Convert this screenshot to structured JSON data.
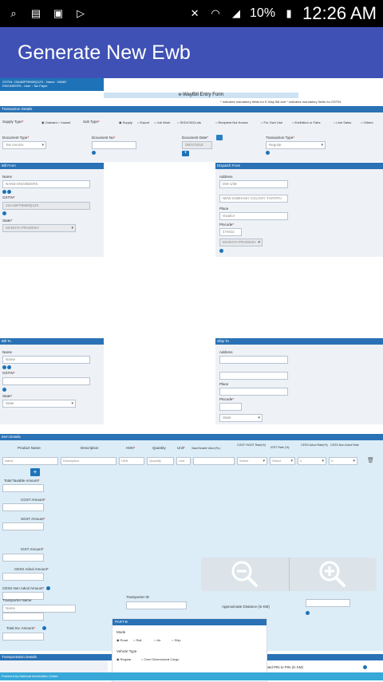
{
  "statusbar": {
    "battery": "10%",
    "time": "12:26 AM"
  },
  "appbar": {
    "title": "Generate New Ewb"
  },
  "web": {
    "userbar_line1": "GSTIN: 23AABFP8969Q1ZX - Name : NAND",
    "userbar_line2": "ENGINEERS - User : Tax Payer",
    "form_title": "e-WayBill Entry Form",
    "mandatory_note": "* Indicates mandatory fields for E-Way Bill and * indicates mandatory fields for GSTIN",
    "transaction_details": {
      "header": "Transaction Details",
      "supply_type_label": "Supply Type",
      "supply_options": [
        "Outward",
        "Inward"
      ],
      "sub_type_label": "Sub Type",
      "sub_types": [
        "Supply",
        "Export",
        "Job Work",
        "SKD/CKD/Lots",
        "Recipient Not Known",
        "For Own Use",
        "Exhibition or Fairs",
        "Line Sales",
        "Others"
      ],
      "doc_type_label": "Document Type",
      "doc_type_value": "Tax Invoice",
      "doc_no_label": "Document No",
      "doc_date_label": "Document Date",
      "doc_date_value": "05/07/2018",
      "transaction_type_label": "Transaction Type",
      "transaction_type_value": "Regular"
    },
    "bill_from": {
      "header": "Bill From",
      "name_label": "Name",
      "name_value": "NAND ENGINEERS",
      "gstin_label": "GSTIN",
      "gstin_value": "23AABFP8969Q1ZX",
      "state_label": "State",
      "state_value": "MADHYA PRADESH"
    },
    "dispatch_from": {
      "header": "Dispatch From",
      "address_label": "Address",
      "address1": "DW-1/38",
      "address2": "NEW SUBHASH COLONY THATIPU",
      "place_label": "Place",
      "place_value": "Gwalior",
      "pincode_label": "Pincode",
      "pincode_value": "474011",
      "state_value": "MADHYA PRADESH"
    },
    "bill_to": {
      "header": "Bill To",
      "name_label": "Name",
      "name_placeholder": "Name",
      "gstin_label": "GSTIN",
      "state_label": "State",
      "state_value": "State"
    },
    "ship_to": {
      "header": "Ship To",
      "address_label": "Address",
      "place_label": "Place",
      "pincode_label": "Pincode",
      "state_value": "State"
    },
    "item_details": {
      "header": "Item Details",
      "columns": [
        "Product Name",
        "Description",
        "HSN",
        "Quantity",
        "Unit",
        "Value/Taxable Value (Rs.)",
        "CGST+SGST Rate(%)",
        "IGST Rate (%)",
        "CESS Advol Rate(%)",
        "CESS Non Advol Rate"
      ],
      "row_placeholders": [
        "Name",
        "Description",
        "HSN",
        "Quantity",
        "Unit",
        "",
        "Select",
        "Select",
        "0",
        "0"
      ],
      "totals": [
        "Total Taxable Amount",
        "CGST Amount",
        "SGST Amount",
        "IGST Amount",
        "CESS Advol Amount",
        "CESS Non Advol Amount",
        "Other Amount(+/-)",
        "Total Inv. Amount"
      ]
    },
    "transportation": {
      "header": "Transportation Details",
      "calc_note": "Auto Calculated PIN to PIN (in KM)",
      "transporter_name_label": "Transporter Name",
      "transporter_name_placeholder": "Name",
      "transporter_id_label": "Transporter ID",
      "approx_distance_label": "Approximate Distance (in KM)",
      "part_b_header": "PART-B",
      "mode_label": "Mode",
      "modes": [
        "Road",
        "Rail",
        "Air",
        "Ship"
      ],
      "vehicle_type_label": "Vehicle Type",
      "vehicle_types": [
        "Regular",
        "Over Dimensional Cargo"
      ]
    },
    "footer_text": "Powered by National Informatics Centre"
  }
}
